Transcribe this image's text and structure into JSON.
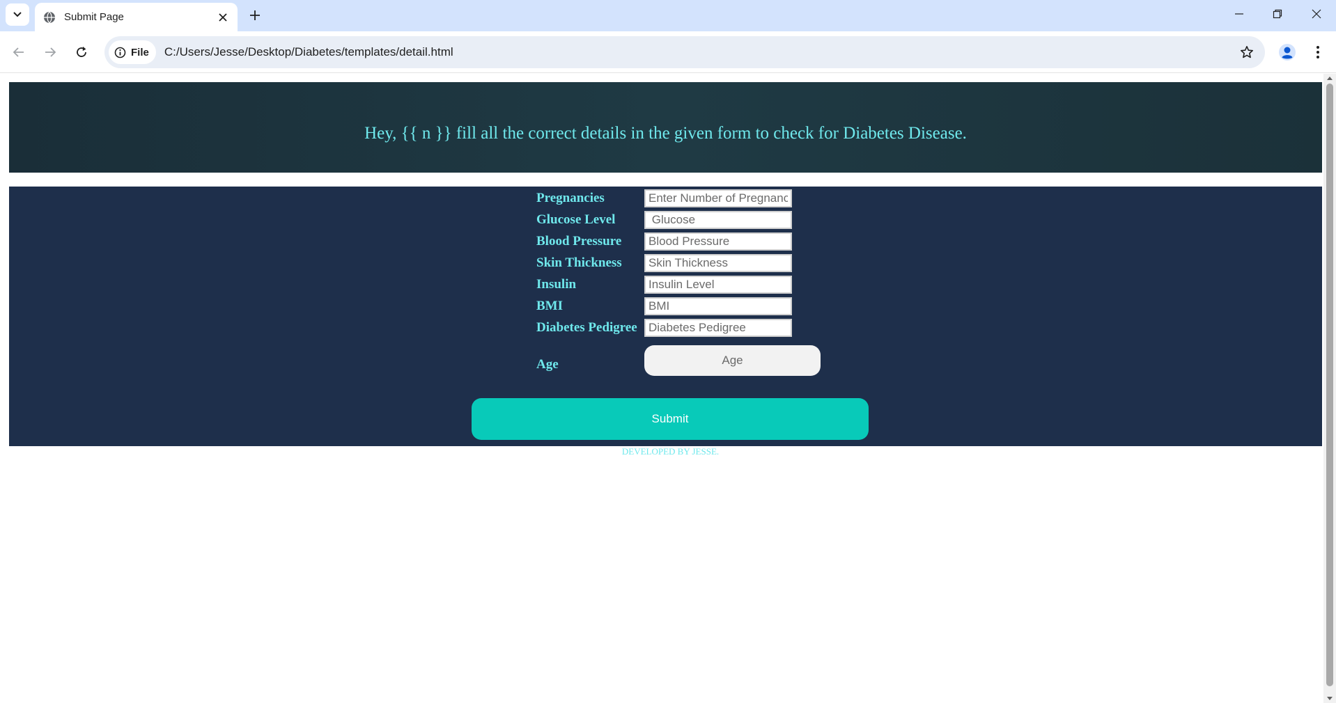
{
  "browser": {
    "tab": {
      "title": "Submit Page",
      "favicon": "globe-icon"
    },
    "address": {
      "scheme_chip": "File",
      "url": "C:/Users/Jesse/Desktop/Diabetes/templates/detail.html"
    },
    "icons": {
      "tab_search": "chevron-down-icon",
      "tab_close": "close-icon",
      "new_tab": "plus-icon",
      "minimize": "minimize-icon",
      "restore": "restore-icon",
      "close_window": "close-icon",
      "back": "back-arrow-icon",
      "forward": "forward-arrow-icon",
      "reload": "reload-icon",
      "site_info": "info-icon",
      "bookmark": "star-icon",
      "profile": "profile-icon",
      "menu": "kebab-menu-icon"
    }
  },
  "page": {
    "header_text": "Hey, {{ n }} fill all the correct details in the given form to check for Diabetes Disease.",
    "fields": [
      {
        "label": "Pregnancies",
        "placeholder": "Enter Number of Pregnancies"
      },
      {
        "label": "Glucose Level",
        "placeholder": " Glucose"
      },
      {
        "label": "Blood Pressure",
        "placeholder": "Blood Pressure"
      },
      {
        "label": "Skin Thickness",
        "placeholder": "Skin Thickness"
      },
      {
        "label": "Insulin",
        "placeholder": "Insulin Level"
      },
      {
        "label": "BMI",
        "placeholder": "BMI"
      },
      {
        "label": "Diabetes Pedigree",
        "placeholder": "Diabetes Pedigree"
      },
      {
        "label": "Age",
        "placeholder": "Age"
      }
    ],
    "submit_label": "Submit",
    "footer_credit": "DEVELOPED BY JESSE."
  },
  "colors": {
    "header_bg": "#1f3a44",
    "form_bg": "#1e2f4b",
    "label_text": "#6fe8ec",
    "submit_bg": "#08cab9",
    "tabstrip_bg": "#d3e3fd"
  }
}
